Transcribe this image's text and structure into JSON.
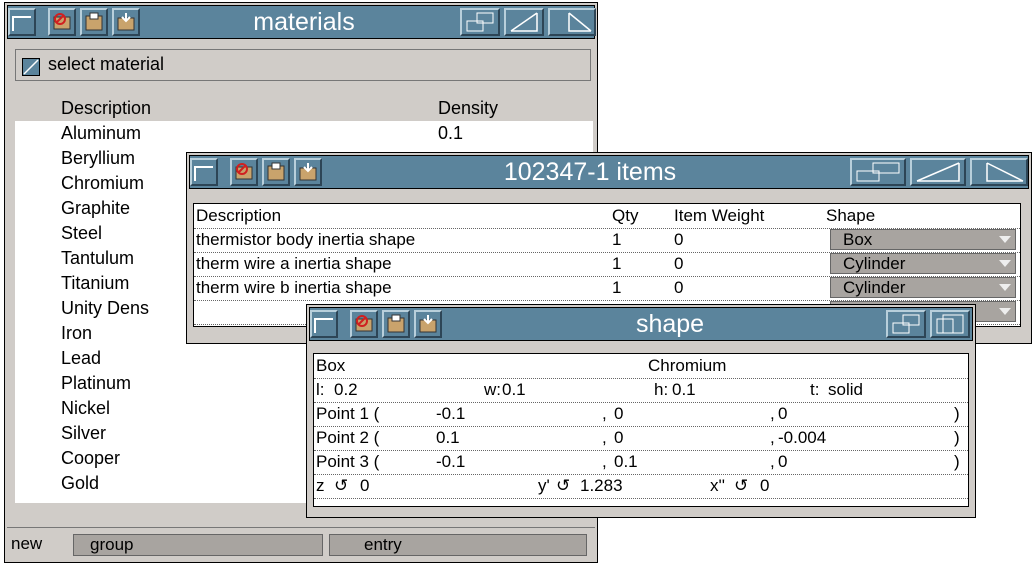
{
  "materials_window": {
    "title": "materials",
    "select_label": "select material",
    "columns": [
      "Description",
      "Density"
    ],
    "rows": [
      {
        "description": "Aluminum",
        "density": "0.1"
      },
      {
        "description": "Beryllium",
        "density": ""
      },
      {
        "description": "Chromium",
        "density": ""
      },
      {
        "description": "Graphite",
        "density": ""
      },
      {
        "description": "Steel",
        "density": ""
      },
      {
        "description": "Tantulum",
        "density": ""
      },
      {
        "description": "Titanium",
        "density": ""
      },
      {
        "description": "Unity Dens",
        "density": ""
      },
      {
        "description": "Iron",
        "density": ""
      },
      {
        "description": "Lead",
        "density": ""
      },
      {
        "description": "Platinum",
        "density": ""
      },
      {
        "description": "Nickel",
        "density": ""
      },
      {
        "description": "Silver",
        "density": ""
      },
      {
        "description": "Cooper",
        "density": ""
      },
      {
        "description": "Gold",
        "density": ""
      }
    ],
    "footer": {
      "new_label": "new",
      "group_label": "group",
      "entry_label": "entry"
    }
  },
  "items_window": {
    "title": "102347-1 items",
    "columns": {
      "description": "Description",
      "qty": "Qty",
      "item_weight": "Item Weight",
      "shape": "Shape"
    },
    "rows": [
      {
        "description": "thermistor body inertia shape",
        "qty": "1",
        "item_weight": "0",
        "shape": "Box"
      },
      {
        "description": "therm wire a inertia shape",
        "qty": "1",
        "item_weight": "0",
        "shape": "Cylinder"
      },
      {
        "description": "therm wire b inertia shape",
        "qty": "1",
        "item_weight": "0",
        "shape": "Cylinder"
      }
    ]
  },
  "shape_window": {
    "title": "shape",
    "type": "Box",
    "material": "Chromium",
    "dims": {
      "l_label": "l:",
      "l": "0.2",
      "w_label": "w:",
      "w": "0.1",
      "h_label": "h:",
      "h": "0.1",
      "t_label": "t:",
      "t": "solid"
    },
    "points": [
      {
        "label": "Point 1 (",
        "x": "-0.1",
        "y": "0",
        "z": "0"
      },
      {
        "label": "Point 2 (",
        "x": "0.1",
        "y": "0",
        "z": "-0.004"
      },
      {
        "label": "Point 3 (",
        "x": "-0.1",
        "y": "0.1",
        "z": "0"
      }
    ],
    "rotation": {
      "z_label": "z",
      "z": "0",
      "y_label": "y'",
      "y": "1.283",
      "x_label": "x''",
      "x": "0"
    }
  },
  "colors": {
    "titlebar": "#5b849c",
    "window_bg": "#d0ccc8",
    "selected_field": "#a8a4a0"
  }
}
